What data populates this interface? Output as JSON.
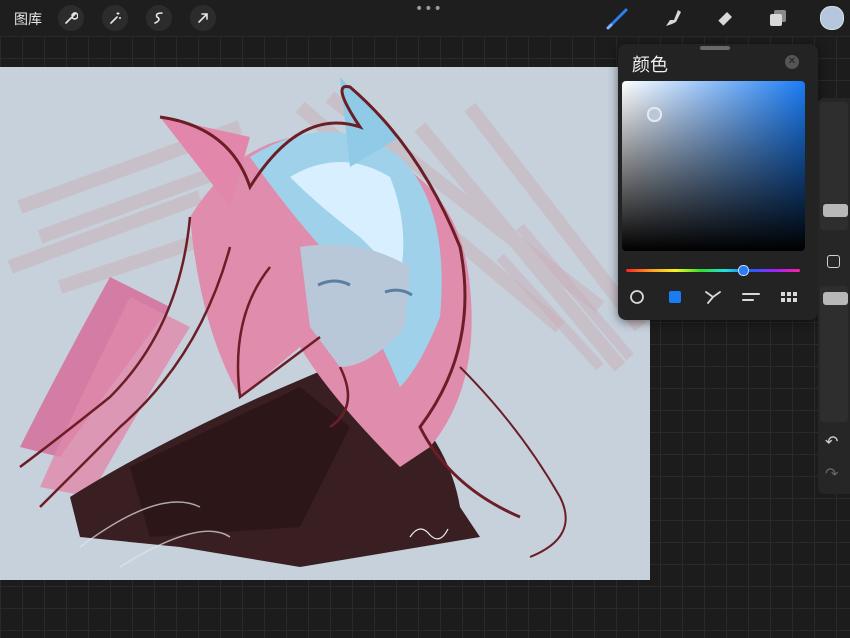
{
  "topbar": {
    "gallery_label": "图库",
    "left_tools": [
      "wrench-icon",
      "magic-wand-icon",
      "selection-icon",
      "transform-arrow-icon"
    ],
    "more_dots": "•••",
    "right_tools": [
      "brush-icon",
      "smudge-icon",
      "eraser-icon",
      "layers-icon"
    ],
    "active_color": "#b6c6dc",
    "brush_accent": "#2c7df3"
  },
  "color_panel": {
    "title": "颜色",
    "close_symbol": "✕",
    "hue_color": "#1a7cf4",
    "selected_color": "#b8c8da",
    "modes": [
      "disc-icon",
      "classic-icon",
      "harmony-icon",
      "value-icon",
      "palettes-icon"
    ],
    "active_mode": "classic-icon"
  },
  "sidebar": {
    "buttons": [
      "brush-size-slider",
      "modify-button",
      "opacity-slider",
      "undo-icon",
      "redo-icon"
    ]
  }
}
